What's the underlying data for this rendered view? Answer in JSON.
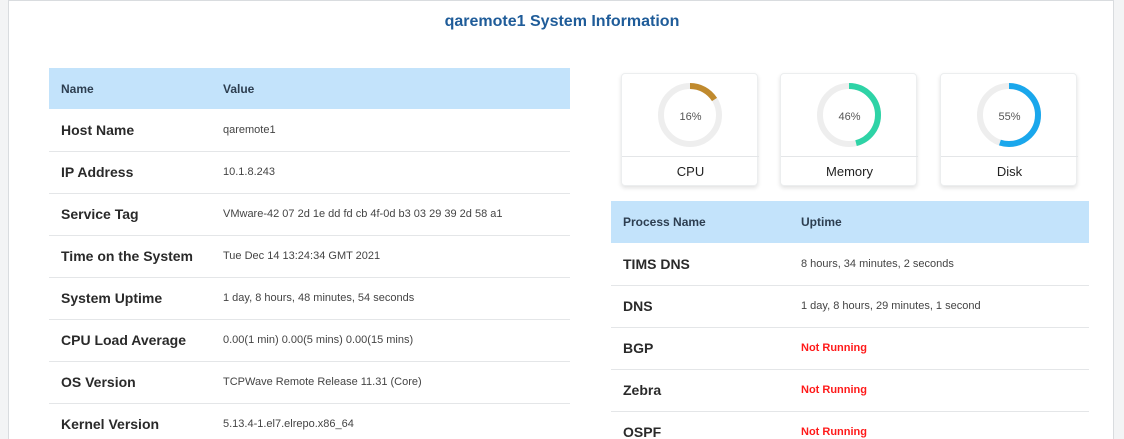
{
  "title": "qaremote1 System Information",
  "system_table": {
    "headers": {
      "name": "Name",
      "value": "Value"
    },
    "rows": [
      {
        "key": "Host Name",
        "value": "qaremote1"
      },
      {
        "key": "IP Address",
        "value": "10.1.8.243"
      },
      {
        "key": "Service Tag",
        "value": "VMware-42 07 2d 1e dd fd cb 4f-0d b3 03 29 39 2d 58 a1"
      },
      {
        "key": "Time on the System",
        "value": "Tue Dec 14 13:24:34 GMT 2021"
      },
      {
        "key": "System Uptime",
        "value": "1 day, 8 hours, 48 minutes, 54 seconds"
      },
      {
        "key": "CPU Load Average",
        "value": "0.00(1 min) 0.00(5 mins) 0.00(15 mins)"
      },
      {
        "key": "OS Version",
        "value": "TCPWave Remote Release 11.31 (Core)"
      },
      {
        "key": "Kernel Version",
        "value": "5.13.4-1.el7.elrepo.x86_64"
      }
    ]
  },
  "gauges": [
    {
      "label": "CPU",
      "percent_text": "16%",
      "percent": 16,
      "color": "#c08a2e"
    },
    {
      "label": "Memory",
      "percent_text": "46%",
      "percent": 46,
      "color": "#2ed3a6"
    },
    {
      "label": "Disk",
      "percent_text": "55%",
      "percent": 55,
      "color": "#1aa7ec"
    }
  ],
  "colors": {
    "track": "#eeeeee",
    "header_bg": "#c3e3fb",
    "title": "#1f5c99",
    "not_running": "#ff1a1a"
  },
  "process_table": {
    "headers": {
      "name": "Process Name",
      "uptime": "Uptime"
    },
    "rows": [
      {
        "name": "TIMS DNS",
        "uptime": "8 hours, 34 minutes, 2 seconds",
        "running": true
      },
      {
        "name": "DNS",
        "uptime": "1 day, 8 hours, 29 minutes, 1 second",
        "running": true
      },
      {
        "name": "BGP",
        "uptime": "Not Running",
        "running": false
      },
      {
        "name": "Zebra",
        "uptime": "Not Running",
        "running": false
      },
      {
        "name": "OSPF",
        "uptime": "Not Running",
        "running": false
      }
    ]
  }
}
